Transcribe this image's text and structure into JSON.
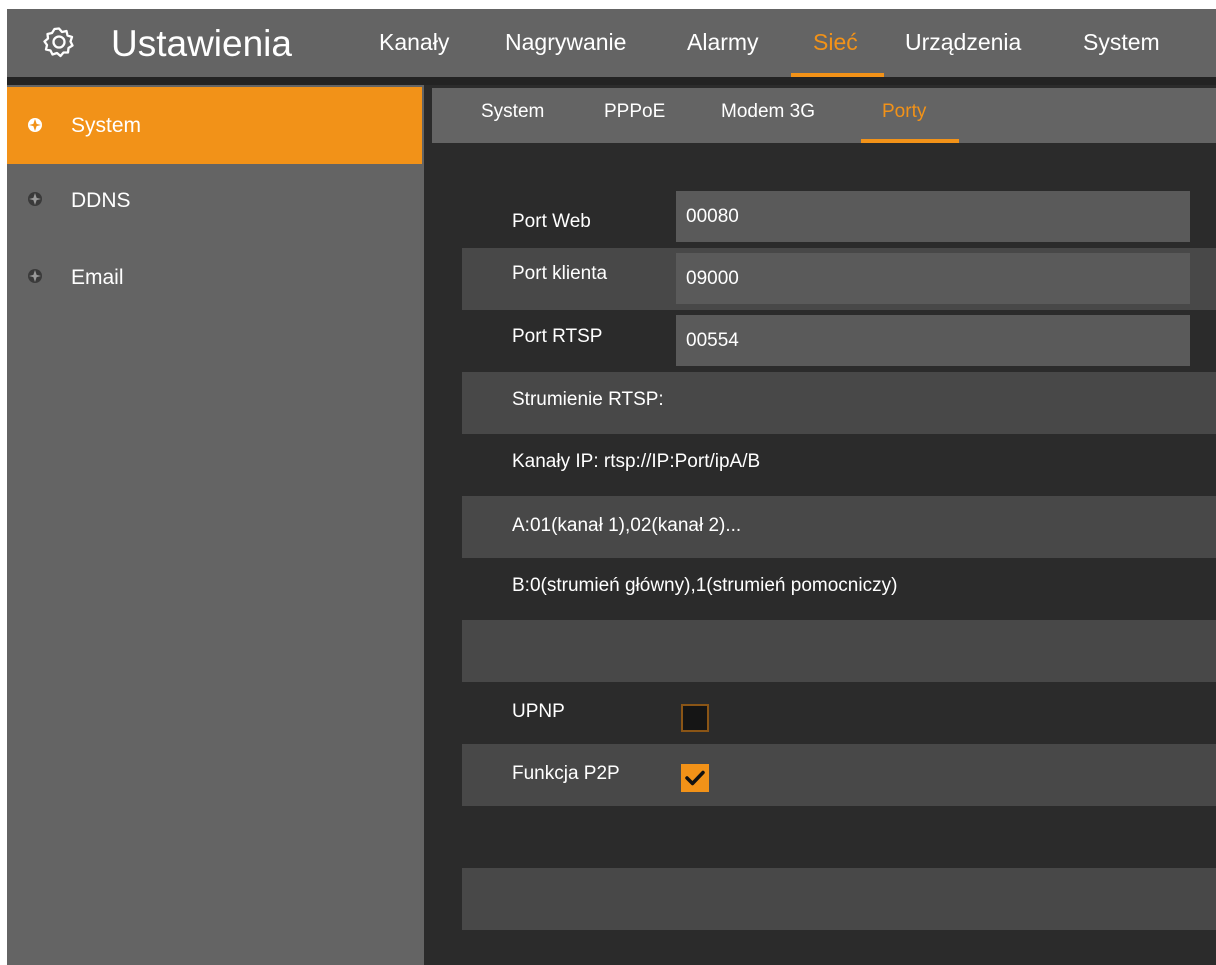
{
  "header": {
    "title": "Ustawienia",
    "app_icon": "gear-icon",
    "tabs": [
      {
        "label": "Kanały"
      },
      {
        "label": "Nagrywanie"
      },
      {
        "label": "Alarmy"
      },
      {
        "label": "Sieć",
        "active": true
      },
      {
        "label": "Urządzenia"
      },
      {
        "label": "System"
      }
    ]
  },
  "sidebar": {
    "items": [
      {
        "label": "System",
        "icon": "compass-icon",
        "active": true
      },
      {
        "label": "DDNS",
        "icon": "compass-icon"
      },
      {
        "label": "Email",
        "icon": "compass-icon"
      }
    ]
  },
  "subtabs": [
    {
      "label": "System"
    },
    {
      "label": "PPPoE"
    },
    {
      "label": "Modem 3G"
    },
    {
      "label": "Porty",
      "active": true
    }
  ],
  "form": {
    "port_web": {
      "label": "Port Web",
      "value": "00080"
    },
    "port_client": {
      "label": "Port klienta",
      "value": "09000"
    },
    "port_rtsp": {
      "label": "Port RTSP",
      "value": "00554"
    },
    "rtsp_streams": "Strumienie RTSP:",
    "ip_channels": "Kanały IP:  rtsp://IP:Port/ipA/B",
    "a_info": "A:01(kanał 1),02(kanał 2)...",
    "b_info": "B:0(strumień główny),1(strumień pomocniczy)",
    "upnp": {
      "label": "UPNP",
      "checked": false
    },
    "p2p": {
      "label": "Funkcja P2P",
      "checked": true
    }
  },
  "colors": {
    "accent": "#f29218",
    "panel": "#646464",
    "background": "#2b2b2b",
    "row_light": "#484848"
  }
}
